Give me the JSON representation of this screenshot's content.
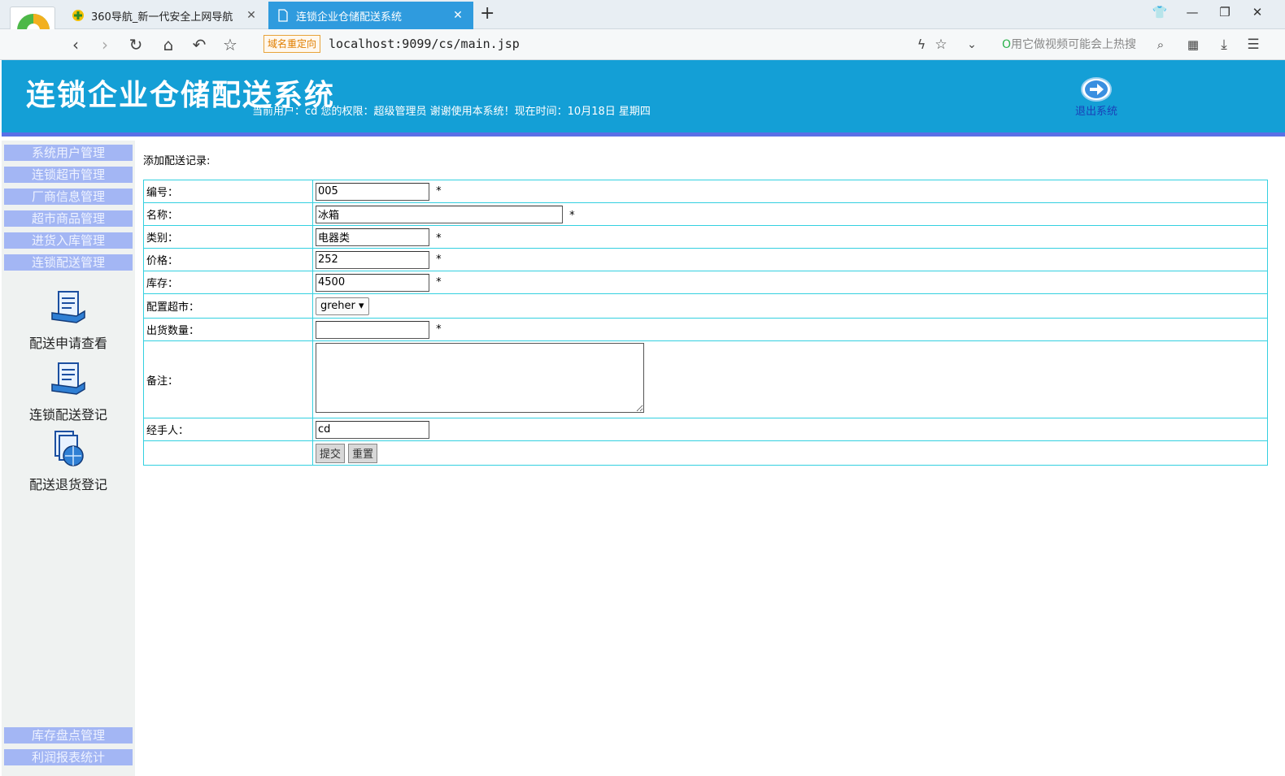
{
  "browser": {
    "tabs": [
      {
        "title": "360导航_新一代安全上网导航",
        "active": false
      },
      {
        "title": "连锁企业仓储配送系统",
        "active": true
      }
    ],
    "redirect_badge": "域名重定向",
    "url": "localhost:9099/cs/main.jsp",
    "search_placeholder": "用它做视频可能会上热搜",
    "accent_color": "#2f9bde"
  },
  "header": {
    "title": "连锁企业仓储配送系统",
    "user_info": "当前用户：cd 您的权限：超级管理员 谢谢使用本系统！现在时间：10月18日 星期四",
    "logout_label": "退出系统",
    "bg_color": "#149fd6"
  },
  "sidebar": {
    "menus": [
      {
        "label": "系统用户管理"
      },
      {
        "label": "连锁超市管理"
      },
      {
        "label": "厂商信息管理"
      },
      {
        "label": "超市商品管理"
      },
      {
        "label": "进货入库管理"
      },
      {
        "label": "连锁配送管理"
      }
    ],
    "submenu": [
      {
        "label": "配送申请查看",
        "icon": "document-send-icon"
      },
      {
        "label": "连锁配送登记",
        "icon": "document-send-icon"
      },
      {
        "label": "配送退货登记",
        "icon": "globe-document-icon"
      }
    ],
    "bottom_menus": [
      {
        "label": "库存盘点管理"
      },
      {
        "label": "利润报表统计"
      }
    ]
  },
  "form": {
    "heading": "添加配送记录:",
    "fields": {
      "code": {
        "label": "编号：",
        "value": "005"
      },
      "name": {
        "label": "名称：",
        "value": "冰箱"
      },
      "category": {
        "label": "类别：",
        "value": "电器类"
      },
      "price": {
        "label": "价格：",
        "value": "252"
      },
      "stock": {
        "label": "库存：",
        "value": "4500"
      },
      "supermarket": {
        "label": "配置超市：",
        "value": "greher"
      },
      "quantity": {
        "label": "出货数量：",
        "value": ""
      },
      "remark": {
        "label": "备注：",
        "value": ""
      },
      "handler": {
        "label": "经手人：",
        "value": "cd"
      }
    },
    "required_mark": "*",
    "submit_label": "提交",
    "reset_label": "重置"
  }
}
